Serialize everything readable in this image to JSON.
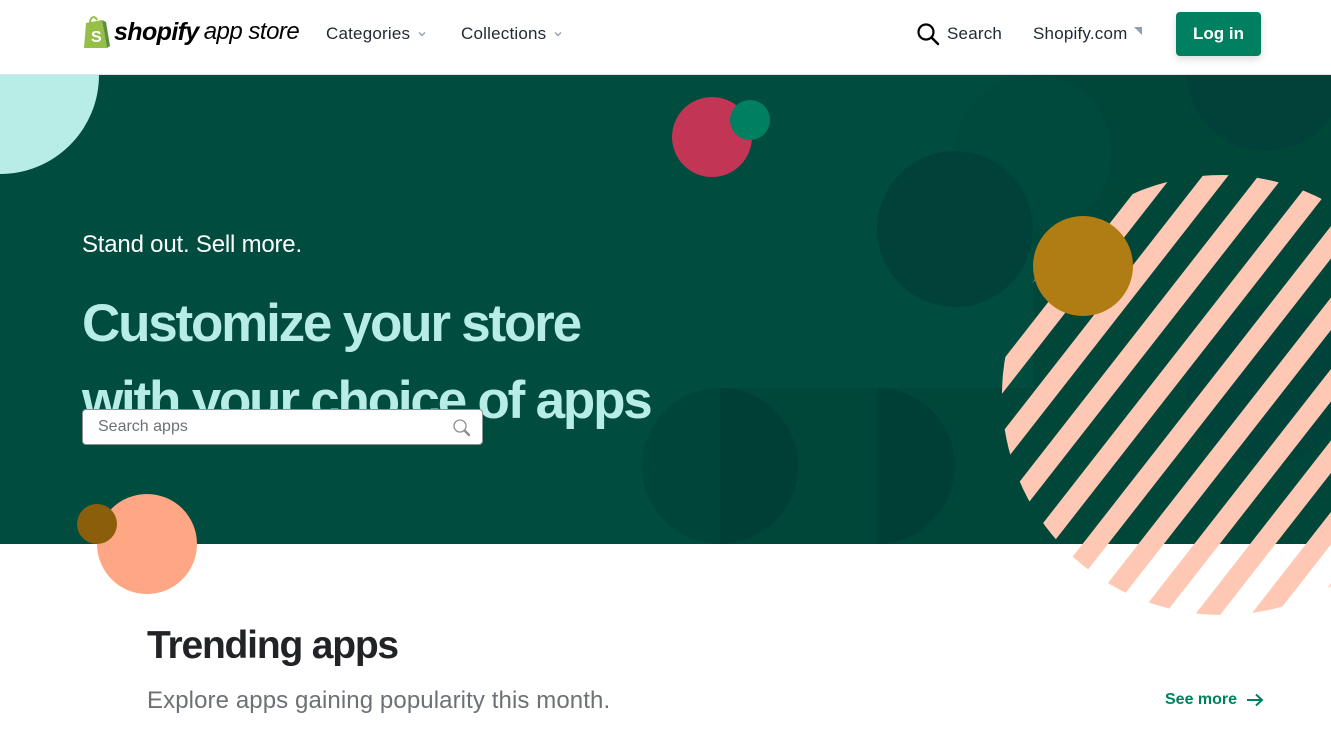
{
  "header": {
    "logo": {
      "brand": "shopify",
      "product": "app store",
      "icon": "shopify-bag-icon"
    },
    "nav": [
      {
        "label": "Categories",
        "icon": "chevron-down-icon"
      },
      {
        "label": "Collections",
        "icon": "chevron-down-icon"
      }
    ],
    "search_label": "Search",
    "search_icon": "search-icon",
    "shopify_link": "Shopify.com",
    "shopify_link_icon": "dropdown-triangle-icon",
    "login_label": "Log in"
  },
  "hero": {
    "tagline": "Stand out. Sell more.",
    "headline_line1": "Customize your store",
    "headline_line2": "with your choice of apps",
    "search": {
      "placeholder": "Search apps",
      "value": "",
      "icon": "search-icon"
    }
  },
  "trending": {
    "title": "Trending apps",
    "subtitle": "Explore apps gaining popularity this month.",
    "see_more_label": "See more",
    "see_more_icon": "arrow-right-icon"
  },
  "colors": {
    "brand_green": "#008060",
    "hero_bg": "#004c3f",
    "hero_headline": "#b7ece7",
    "accent_pink": "#c33555",
    "accent_gold": "#b07d14",
    "accent_peach": "#ffa685",
    "stripe_peach": "#ffc8b4"
  }
}
